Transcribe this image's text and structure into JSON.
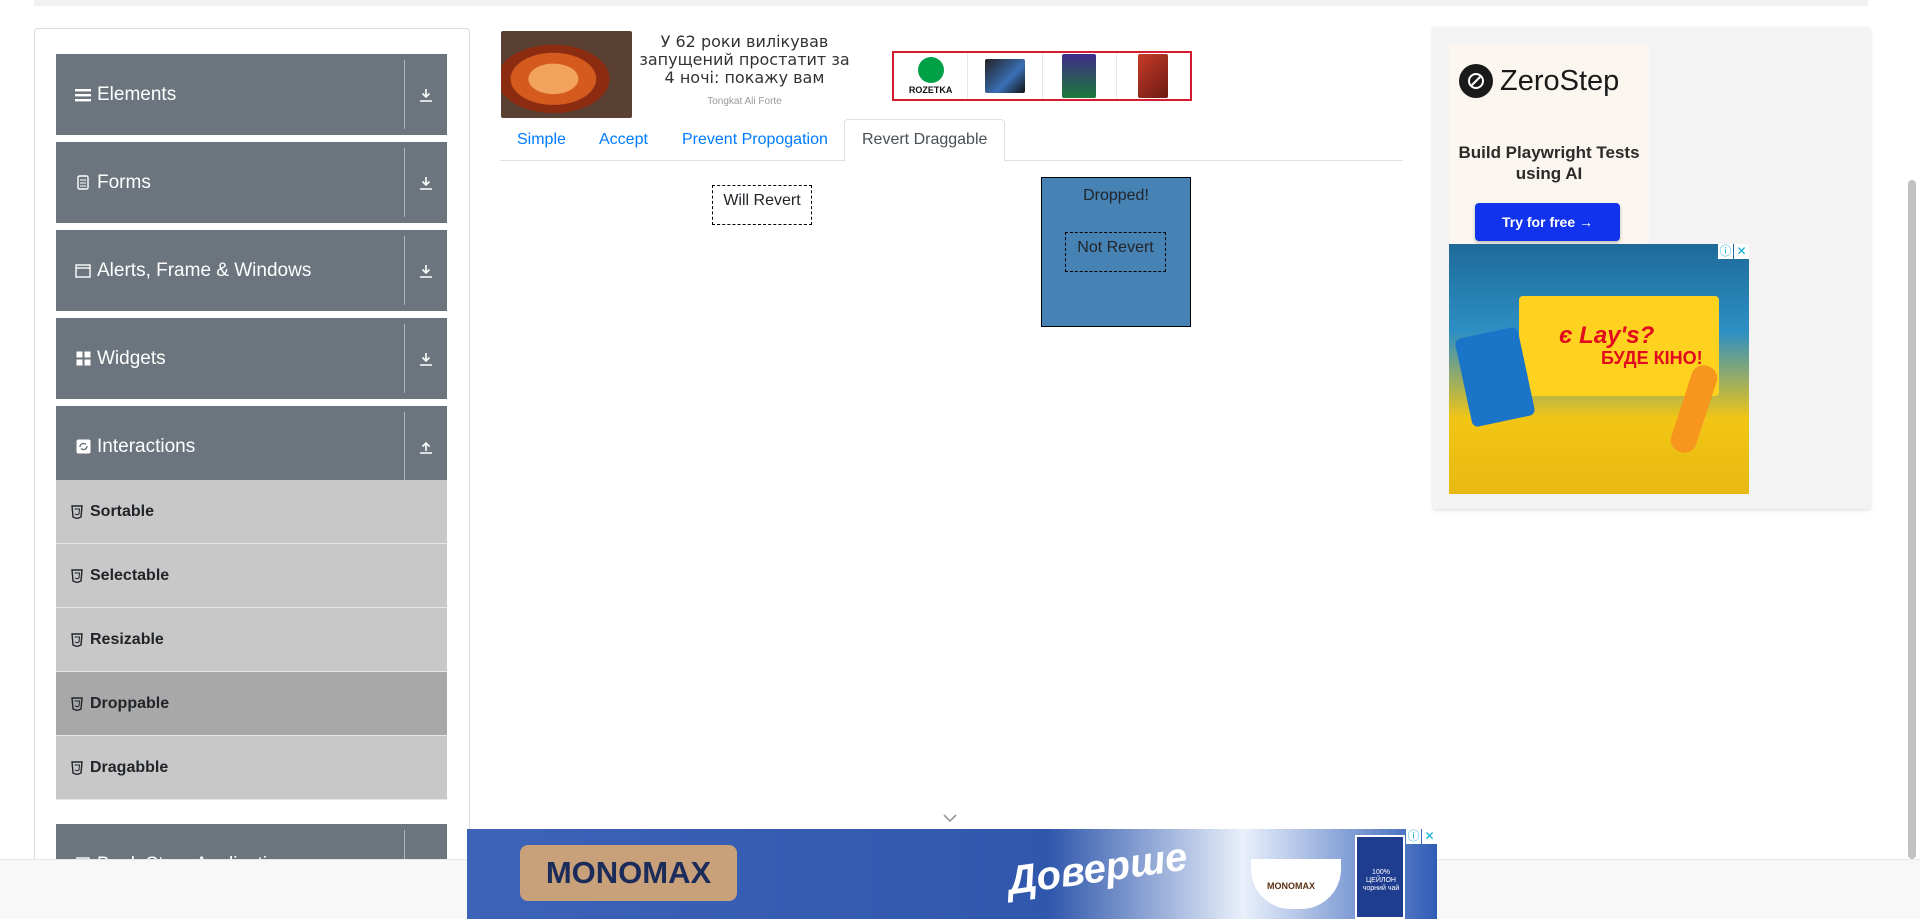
{
  "sidebar": {
    "groups": [
      {
        "label": "Elements",
        "icon": "hamburger-icon",
        "arrow": "download-icon"
      },
      {
        "label": "Forms",
        "icon": "form-icon",
        "arrow": "download-icon"
      },
      {
        "label": "Alerts, Frame & Windows",
        "icon": "window-icon",
        "arrow": "download-icon"
      },
      {
        "label": "Widgets",
        "icon": "widgets-icon",
        "arrow": "download-icon"
      },
      {
        "label": "Interactions",
        "icon": "interactions-icon",
        "arrow": "upload-icon"
      },
      {
        "label": "Book Store Application",
        "icon": "book-icon",
        "arrow": "download-icon"
      }
    ],
    "items": [
      {
        "label": "Sortable",
        "active": false
      },
      {
        "label": "Selectable",
        "active": false
      },
      {
        "label": "Resizable",
        "active": false
      },
      {
        "label": "Droppable",
        "active": true
      },
      {
        "label": "Dragabble",
        "active": false
      }
    ]
  },
  "ad_top": {
    "text": "У 62 роки вилікував запущений простатит за 4 ночі: покажу вам",
    "source": "Tongkat Ali Forte",
    "rozetka_label": "ROZETKA"
  },
  "tabs": [
    {
      "label": "Simple",
      "active": false
    },
    {
      "label": "Accept",
      "active": false
    },
    {
      "label": "Prevent Propogation",
      "active": false
    },
    {
      "label": "Revert Draggable",
      "active": true
    }
  ],
  "revert": {
    "will_revert": "Will Revert",
    "dropped": "Dropped!",
    "not_revert": "Not Revert"
  },
  "zerostep": {
    "name": "ZeroStep",
    "subtitle": "Build Playwright Tests using AI",
    "button": "Try for free →"
  },
  "lays": {
    "title": "є Lay's?",
    "subtitle": "БУДЕ КІНО!"
  },
  "bottom_ad": {
    "brand": "MONOMAX",
    "slogan": "Доверше",
    "cup_label": "MONOMAX",
    "box_text": "100% ЦЕЙЛОН чорний чай"
  },
  "colors": {
    "sidebar_group": "#6c757d",
    "sidebar_item": "#c8c8c8",
    "sidebar_item_active": "#a8a8a8",
    "link": "#007bff",
    "droppable": "#4682b4",
    "zerostep_button": "#1133ee"
  }
}
